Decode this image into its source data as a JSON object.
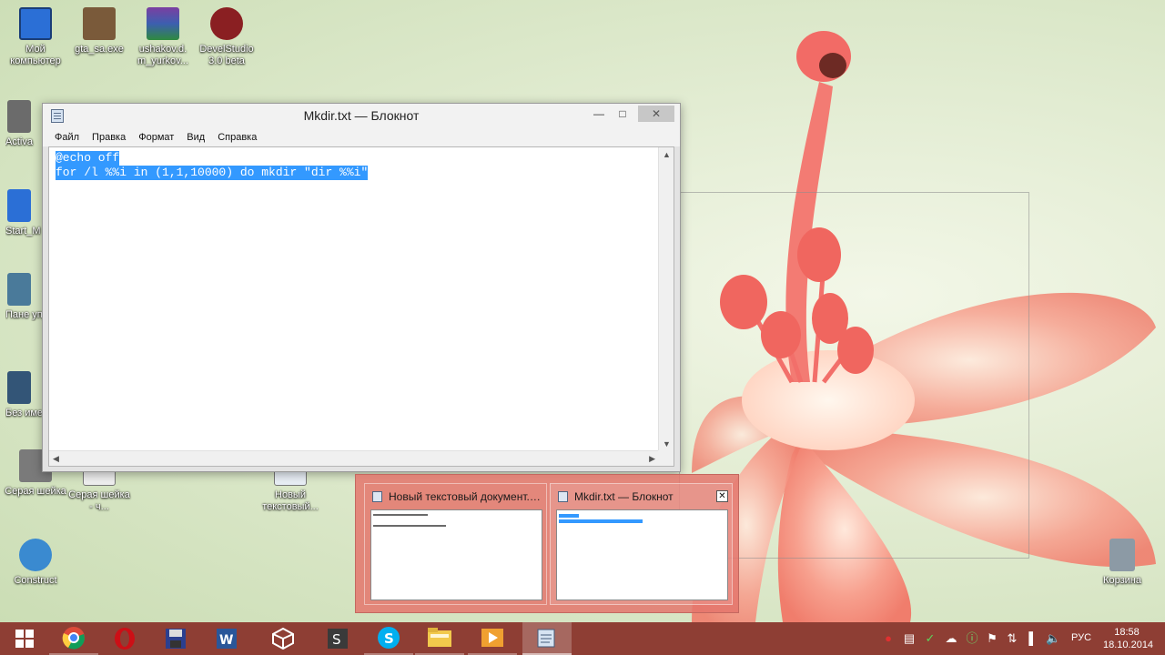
{
  "desktop": {
    "icons": [
      {
        "label": "Мой компьютер"
      },
      {
        "label": "gta_sa.exe"
      },
      {
        "label": "ushakov.d. m_yurkov..."
      },
      {
        "label": "DevelStudio 3.0 beta"
      },
      {
        "label": "Activa"
      },
      {
        "label": "Start_M"
      },
      {
        "label": "Пане управл"
      },
      {
        "label": "Без имени"
      },
      {
        "label": "Серая шейка"
      },
      {
        "label": "Серая шейка - ч..."
      },
      {
        "label": "Новый текстовый..."
      },
      {
        "label": "Construct"
      },
      {
        "label": "Корзина"
      }
    ]
  },
  "notepad": {
    "title": "Mkdir.txt — Блокнот",
    "menu": [
      "Файл",
      "Правка",
      "Формат",
      "Вид",
      "Справка"
    ],
    "lines": [
      "@echo off",
      "for /l %%i in (1,1,10000) do mkdir \"dir %%i\""
    ]
  },
  "thumbnails": [
    {
      "title": "Новый текстовый документ.txt..."
    },
    {
      "title": "Mkdir.txt — Блокнот"
    }
  ],
  "taskbar": {
    "apps": [
      "start-icon",
      "chrome-icon",
      "opera-icon",
      "floppy-icon",
      "word-icon",
      "unity-icon",
      "dev-icon",
      "skype-icon",
      "explorer-icon",
      "media-icon",
      "notepad-icon"
    ],
    "language": "РУС",
    "time": "18:58",
    "date": "18.10.2014"
  }
}
